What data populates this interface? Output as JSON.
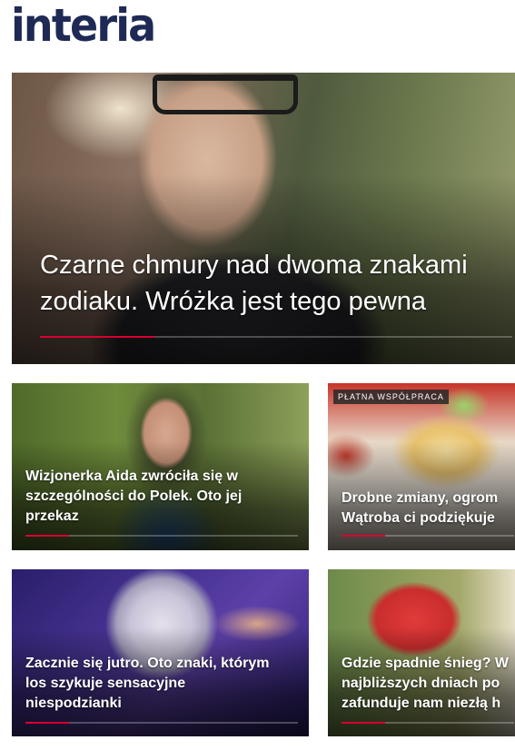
{
  "header": {
    "logo_text": "interia"
  },
  "hero": {
    "title": "Czarne chmury nad dwoma znakami\nzodiaku. Wróżka jest tego pewna"
  },
  "articles": [
    {
      "title": "Wizjonerka Aida zwróciła się w\nszczególności do Polek. Oto jej\nprzekaz",
      "badge": ""
    },
    {
      "title": "Drobne zmiany, ogrom\nWątroba ci podziękuje",
      "badge": "PŁATNA WSPÓŁPRACA"
    },
    {
      "title": "Zacznie się jutro. Oto znaki, którym\nlos szykuje sensacyjne\nniespodzianki",
      "badge": ""
    },
    {
      "title": "Gdzie spadnie śnieg? W\nnajbliższych dniach po\nzafunduje nam niezłą h",
      "badge": ""
    }
  ],
  "colors": {
    "logo": "#1e2a55",
    "accent": "#d8002f"
  }
}
